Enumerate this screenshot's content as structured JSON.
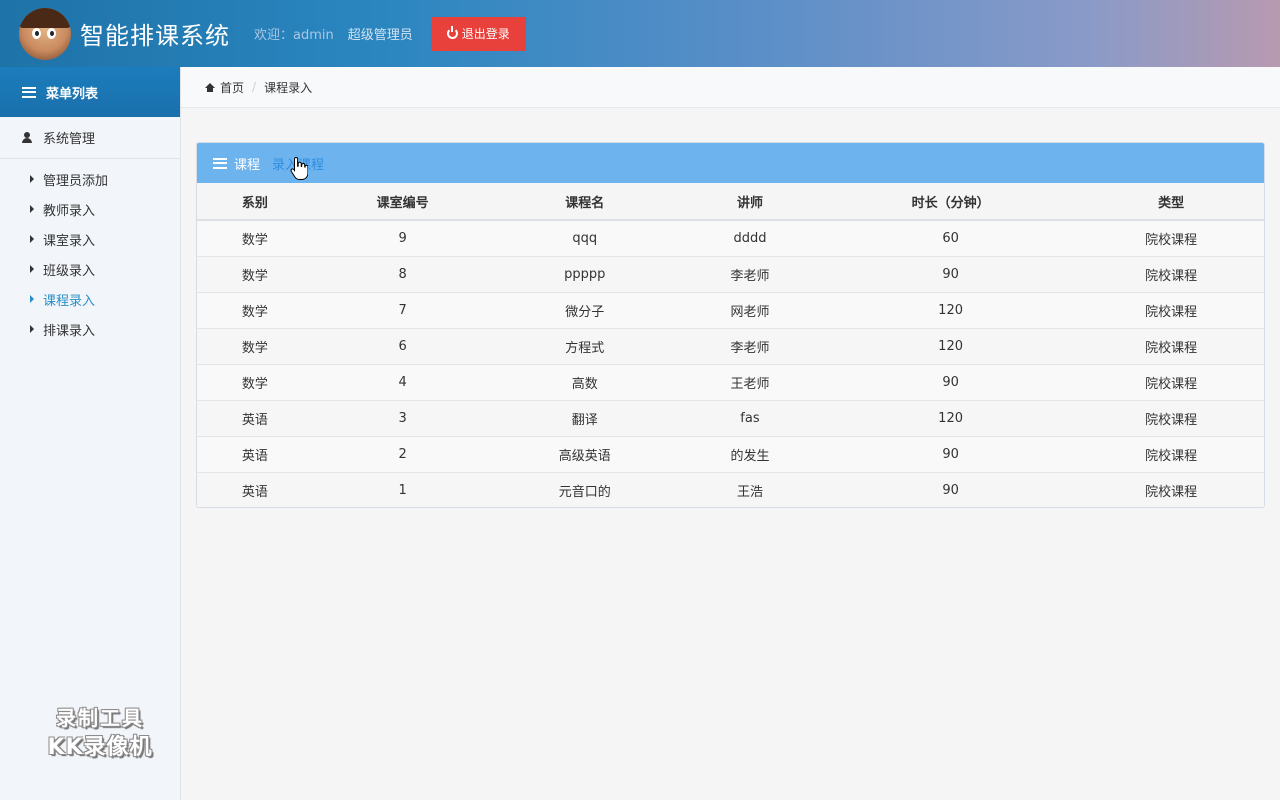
{
  "header": {
    "app_title": "智能排课系统",
    "welcome": "欢迎：admin",
    "role": "超级管理员",
    "logout_label": "退出登录"
  },
  "sidebar": {
    "menu_title": "菜单列表",
    "group_title": "系统管理",
    "items": [
      {
        "label": "管理员添加",
        "active": false
      },
      {
        "label": "教师录入",
        "active": false
      },
      {
        "label": "课室录入",
        "active": false
      },
      {
        "label": "班级录入",
        "active": false
      },
      {
        "label": "课程录入",
        "active": true
      },
      {
        "label": "排课录入",
        "active": false
      }
    ]
  },
  "breadcrumb": {
    "home": "首页",
    "current": "课程录入"
  },
  "panel": {
    "title": "课程",
    "action_link": "录入课程",
    "columns": [
      "系别",
      "课室编号",
      "课程名",
      "讲师",
      "时长（分钟）",
      "类型"
    ],
    "rows": [
      [
        "数学",
        "9",
        "qqq",
        "dddd",
        "60",
        "院校课程"
      ],
      [
        "数学",
        "8",
        "ppppp",
        "李老师",
        "90",
        "院校课程"
      ],
      [
        "数学",
        "7",
        "微分子",
        "网老师",
        "120",
        "院校课程"
      ],
      [
        "数学",
        "6",
        "方程式",
        "李老师",
        "120",
        "院校课程"
      ],
      [
        "数学",
        "4",
        "高数",
        "王老师",
        "90",
        "院校课程"
      ],
      [
        "英语",
        "3",
        "翻译",
        "fas",
        "120",
        "院校课程"
      ],
      [
        "英语",
        "2",
        "高级英语",
        "的发生",
        "90",
        "院校课程"
      ],
      [
        "英语",
        "1",
        "元音口的",
        "王浩",
        "90",
        "院校课程"
      ]
    ]
  },
  "watermark": {
    "line1": "录制工具",
    "line2": "KK录像机"
  },
  "colors": {
    "header_start": "#1e73a8",
    "logout_bg": "#e8403b",
    "panel_head_bg": "#6db3ee",
    "active_link": "#2a8fc8"
  }
}
